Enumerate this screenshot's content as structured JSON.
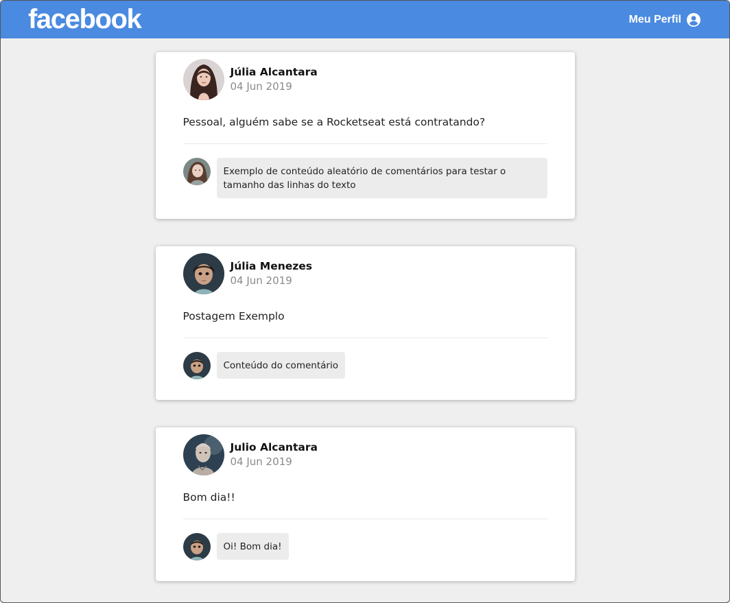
{
  "header": {
    "logo": "facebook",
    "profile_label": "Meu Perfil",
    "profile_icon": "user-circle-icon",
    "bg_color": "#4a8ae0"
  },
  "posts": [
    {
      "author": "Júlia Alcantara",
      "date": "04 Jun 2019",
      "content": "Pessoal, alguém sabe se a Rocketseat está contratando?",
      "comments": [
        {
          "content": "Exemplo de conteúdo aleatório de comentários para testar o tamanho das linhas do texto"
        }
      ]
    },
    {
      "author": "Júlia Menezes",
      "date": "04 Jun 2019",
      "content": "Postagem Exemplo",
      "comments": [
        {
          "content": "Conteúdo do comentário"
        }
      ]
    },
    {
      "author": "Julio Alcantara",
      "date": "04 Jun 2019",
      "content": "Bom dia!!",
      "comments": [
        {
          "content": "Oi! Bom dia!"
        }
      ]
    }
  ]
}
